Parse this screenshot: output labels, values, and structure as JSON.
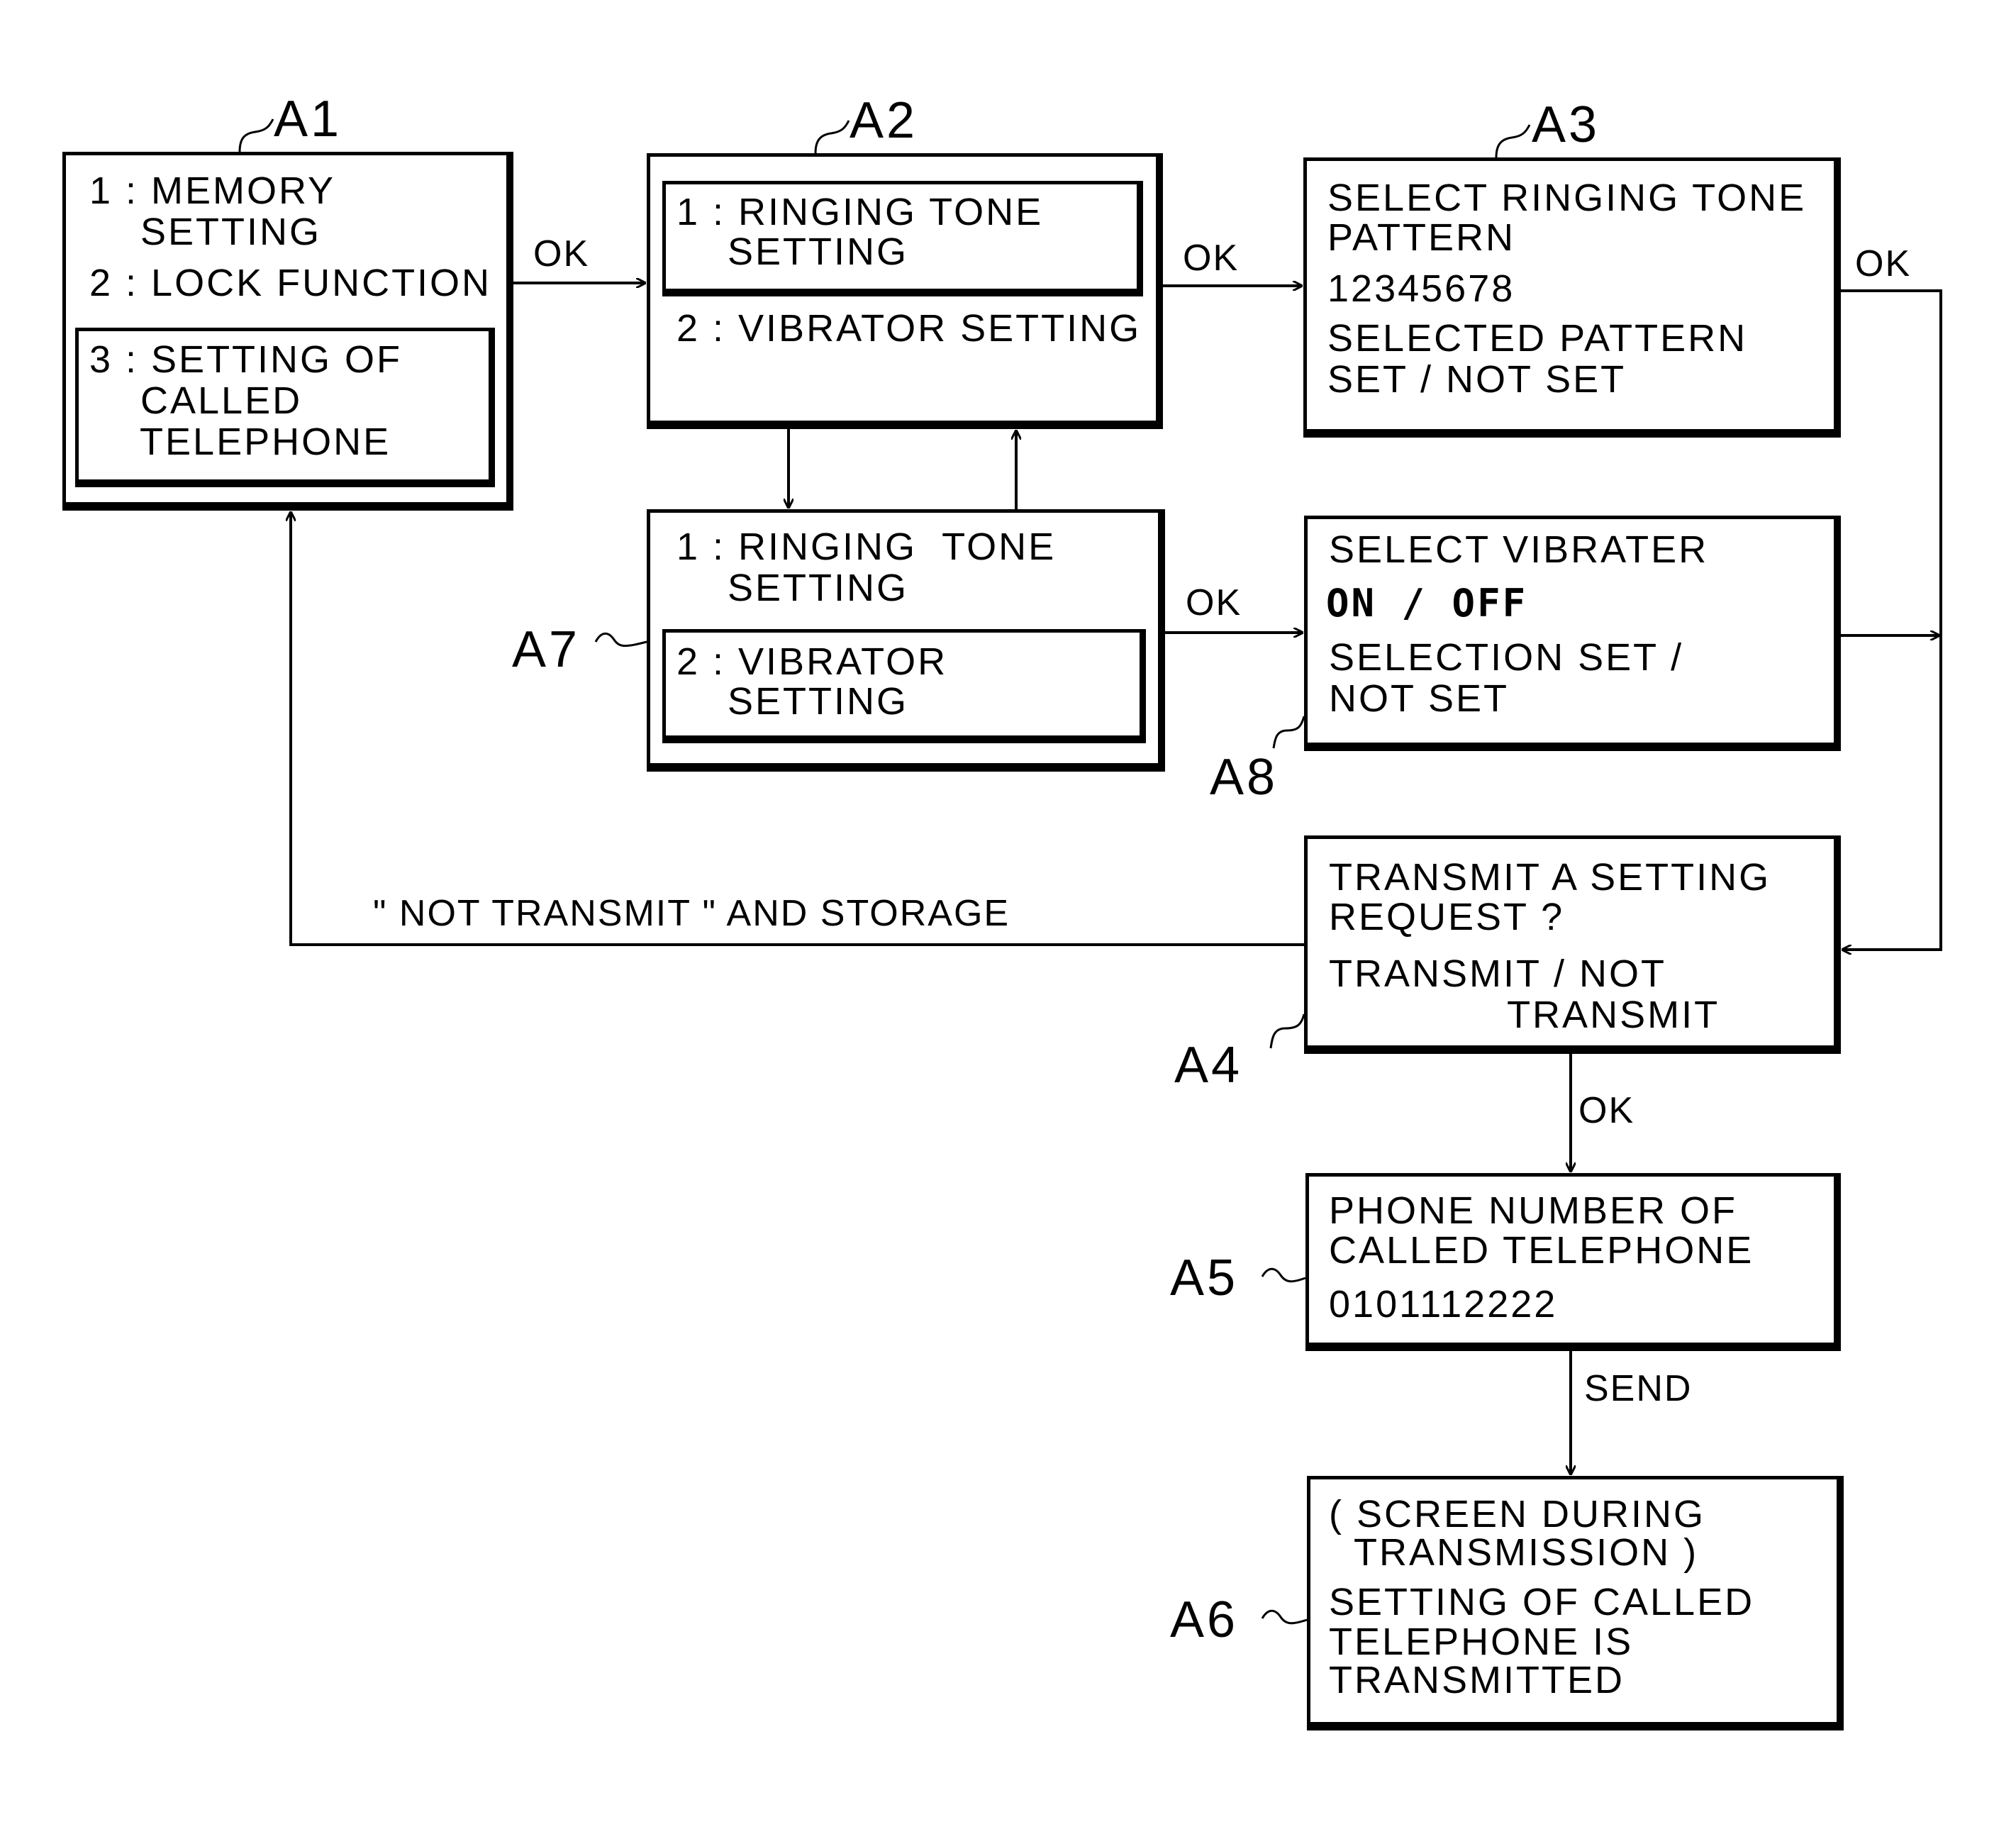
{
  "diagram": {
    "nodes": {
      "A1": {
        "label": "A1",
        "items": [
          "1 : MEMORY",
          "    SETTING",
          "2 : LOCK FUNCTION"
        ],
        "selected": [
          "3 : SETTING OF",
          "    CALLED",
          "    TELEPHONE"
        ]
      },
      "A2": {
        "label": "A2",
        "selected": [
          "1 : RINGING TONE",
          "    SETTING"
        ],
        "items": [
          "2 : VIBRATOR SETTING"
        ]
      },
      "A3": {
        "label": "A3",
        "lines": [
          "SELECT RINGING TONE",
          "PATTERN",
          "12345678",
          "SELECTED PATTERN",
          "SET / NOT SET"
        ]
      },
      "A7": {
        "label": "A7",
        "items": [
          "1 : RINGING  TONE",
          "    SETTING"
        ],
        "selected": [
          "2 : VIBRATOR",
          "    SETTING"
        ]
      },
      "A8": {
        "label": "A8",
        "lines": [
          "SELECT VIBRATER",
          "ON / OFF",
          "SELECTION SET /",
          "NOT SET"
        ]
      },
      "A4": {
        "label": "A4",
        "lines": [
          "TRANSMIT A SETTING",
          "REQUEST ?",
          "TRANSMIT / NOT",
          "              TRANSMIT"
        ]
      },
      "A5": {
        "label": "A5",
        "lines": [
          "PHONE NUMBER OF",
          "CALLED TELEPHONE",
          "0101112222"
        ]
      },
      "A6": {
        "label": "A6",
        "lines": [
          "( SCREEN DURING",
          "  TRANSMISSION )",
          "SETTING OF CALLED",
          "TELEPHONE IS",
          "TRANSMITTED"
        ]
      }
    },
    "edges": {
      "a1_a2": "OK",
      "a2_a3": "OK",
      "a3_a4": "OK",
      "a7_a8": "OK",
      "a4_a5": "OK",
      "a5_a6": "SEND",
      "a4_a1": "\" NOT TRANSMIT \" AND STORAGE"
    }
  }
}
